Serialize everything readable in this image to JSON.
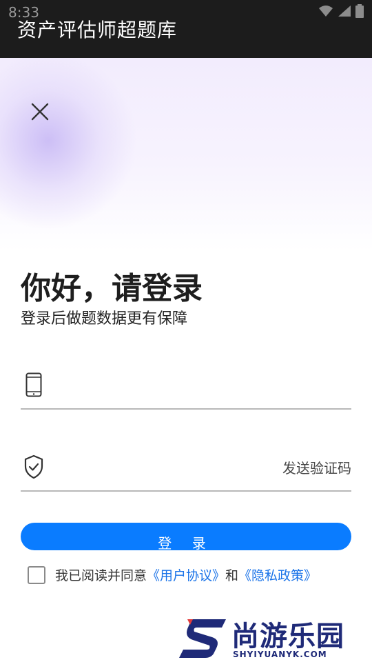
{
  "status_bar": {
    "time": "8:33",
    "icons": [
      "wifi-icon",
      "signal-icon",
      "battery-icon"
    ]
  },
  "app_bar": {
    "title": "资产评估师超题库"
  },
  "header": {
    "close_icon": "close-icon",
    "greeting": "你好，请登录",
    "subtitle": "登录后做题数据更有保障"
  },
  "form": {
    "phone": {
      "icon": "phone-icon",
      "value": "",
      "placeholder": ""
    },
    "code": {
      "icon": "shield-check-icon",
      "value": "",
      "placeholder": "",
      "send_label": "发送验证码"
    },
    "login_label": "登 录"
  },
  "agreement": {
    "checked": false,
    "prefix": "我已阅读并同意",
    "user_agreement": "《用户协议》",
    "conjunction": "和",
    "privacy_policy": "《隐私政策》"
  },
  "watermark": {
    "name": "尚游乐园",
    "domain": "SHYIYUANYK.COM"
  },
  "colors": {
    "accent": "#0a7cff",
    "link": "#1a73e8",
    "top_bar": "#1c1c1c",
    "watermark": "#1f2a78"
  }
}
